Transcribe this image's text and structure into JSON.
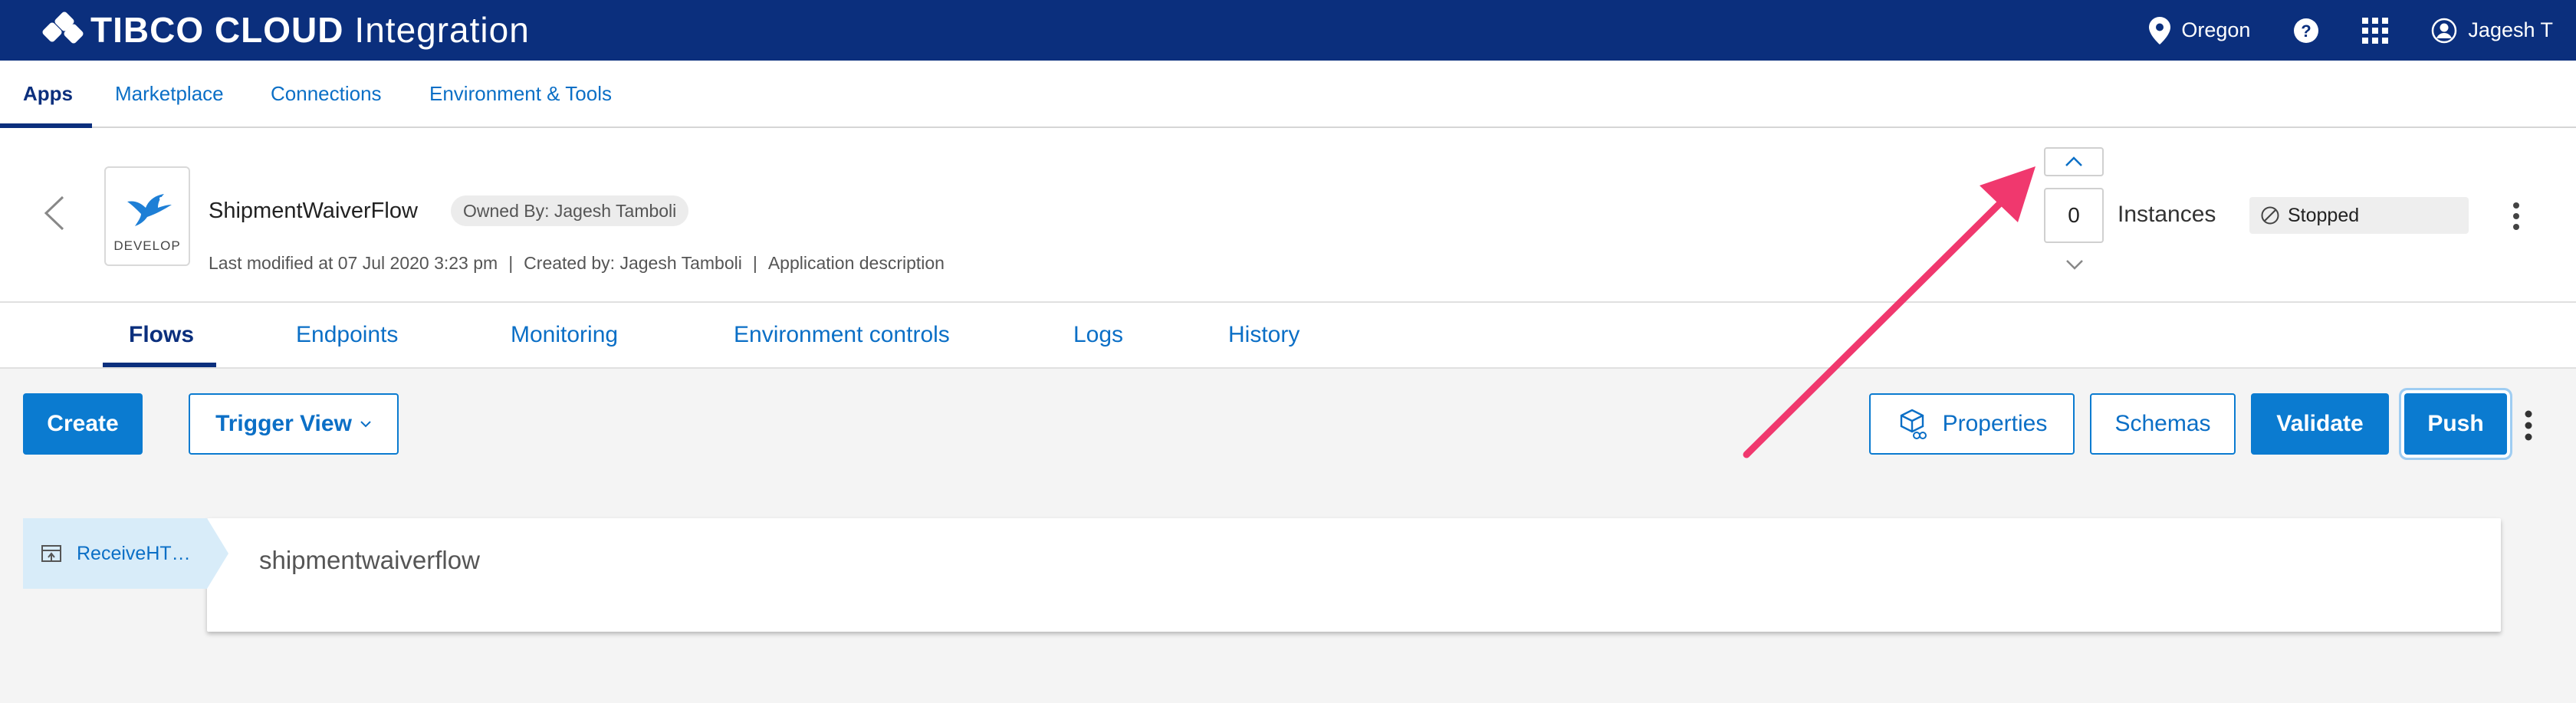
{
  "header": {
    "brand_main": "TIBCO CLOUD",
    "brand_sub": "Integration",
    "region": "Oregon",
    "user": "Jagesh T",
    "icons": [
      "location-pin-icon",
      "help-icon",
      "app-grid-icon",
      "user-icon"
    ]
  },
  "nav": {
    "items": [
      {
        "label": "Apps"
      },
      {
        "label": "Marketplace"
      },
      {
        "label": "Connections"
      },
      {
        "label": "Environment & Tools"
      }
    ]
  },
  "app": {
    "tile_label": "DEVELOP",
    "name": "ShipmentWaiverFlow",
    "owner": "Owned By: Jagesh Tamboli",
    "last_modified": "Last modified at 07 Jul 2020 3:23 pm",
    "created_by": "Created by: Jagesh Tamboli",
    "description": "Application description",
    "separator": "|",
    "instances_value": "0",
    "instances_label": "Instances",
    "status": "Stopped"
  },
  "tabs": {
    "items": [
      {
        "label": "Flows"
      },
      {
        "label": "Endpoints"
      },
      {
        "label": "Monitoring"
      },
      {
        "label": "Environment controls"
      },
      {
        "label": "Logs"
      },
      {
        "label": "History"
      }
    ]
  },
  "toolbar": {
    "create": "Create",
    "trigger_view": "Trigger View",
    "properties": "Properties",
    "schemas": "Schemas",
    "validate": "Validate",
    "push": "Push"
  },
  "flow": {
    "trigger_label": "ReceiveHT…",
    "name": "shipmentwaiverflow"
  },
  "colors": {
    "header_bg": "#0b2f7d",
    "accent": "#0b7bd0",
    "annotation_arrow": "#f0386e"
  }
}
